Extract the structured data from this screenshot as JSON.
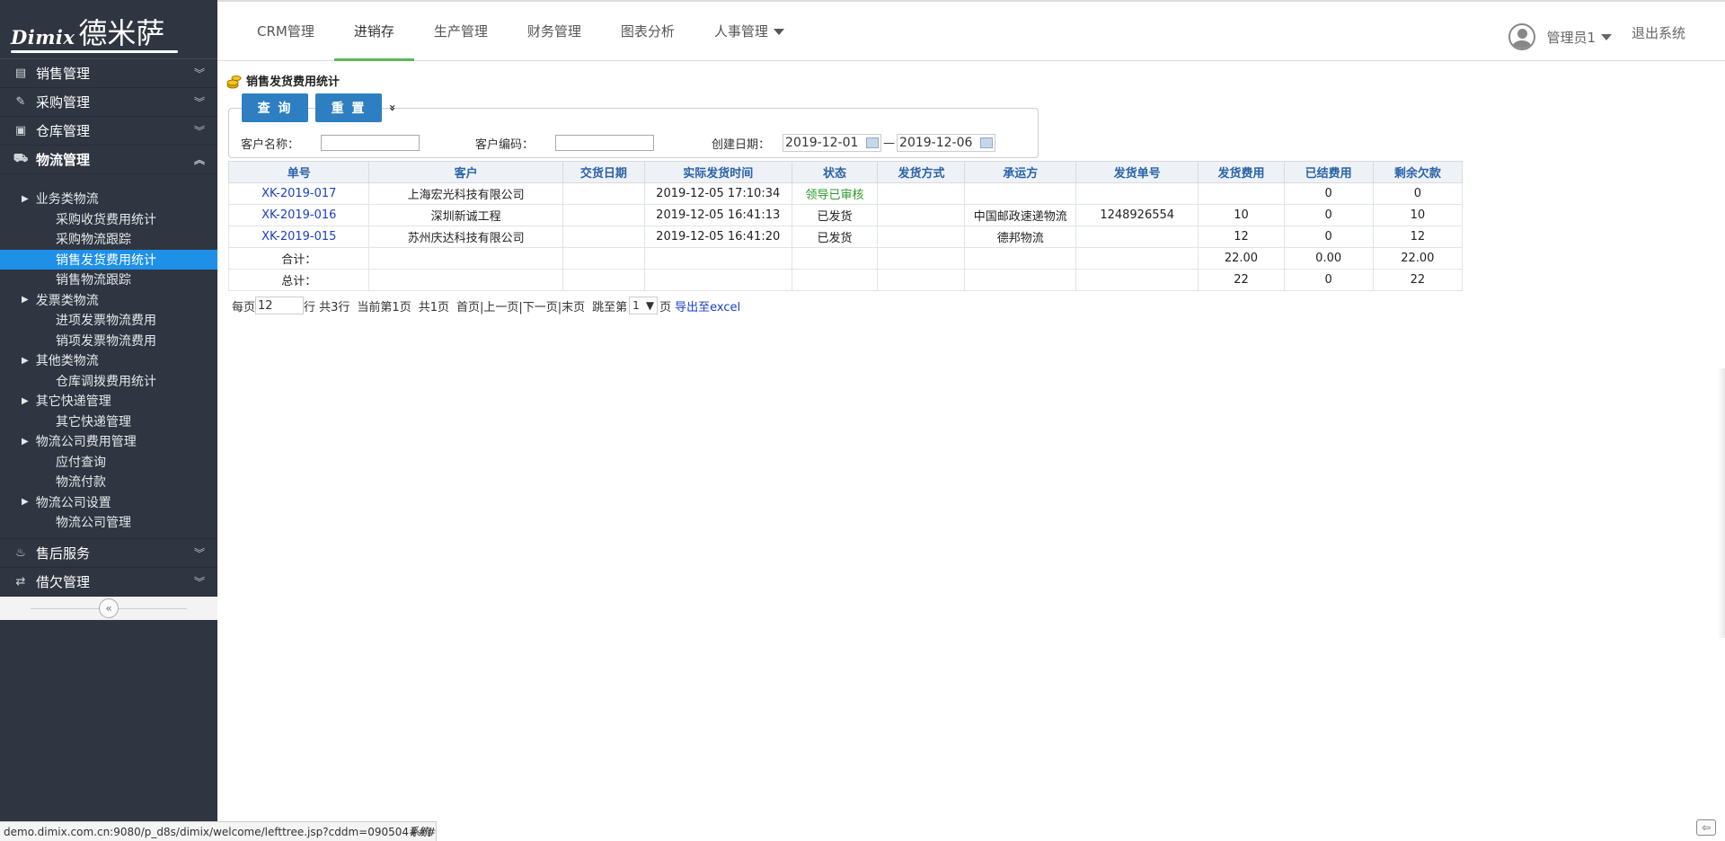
{
  "logo": {
    "en": "Dimix",
    "cn": "德米萨"
  },
  "sidebar": {
    "menus_top": [
      {
        "label": "销售管理",
        "icon": "table-icon",
        "glyph": "▤"
      },
      {
        "label": "采购管理",
        "icon": "edit-icon",
        "glyph": "✎"
      },
      {
        "label": "仓库管理",
        "icon": "warehouse-icon",
        "glyph": "▣"
      },
      {
        "label": "物流管理",
        "icon": "logistics-icon",
        "glyph": "⛟"
      }
    ],
    "tree": [
      {
        "type": "group",
        "label": "业务类物流"
      },
      {
        "type": "leaf",
        "label": "采购收货费用统计"
      },
      {
        "type": "leaf",
        "label": "采购物流跟踪"
      },
      {
        "type": "leaf",
        "label": "销售发货费用统计",
        "active": true
      },
      {
        "type": "leaf",
        "label": "销售物流跟踪"
      },
      {
        "type": "group",
        "label": "发票类物流"
      },
      {
        "type": "leaf",
        "label": "进项发票物流费用"
      },
      {
        "type": "leaf",
        "label": "销项发票物流费用"
      },
      {
        "type": "group",
        "label": "其他类物流"
      },
      {
        "type": "leaf",
        "label": "仓库调拨费用统计"
      },
      {
        "type": "group",
        "label": "其它快递管理"
      },
      {
        "type": "leaf",
        "label": "其它快递管理"
      },
      {
        "type": "group",
        "label": "物流公司费用管理"
      },
      {
        "type": "leaf",
        "label": "应付查询"
      },
      {
        "type": "leaf",
        "label": "物流付款"
      },
      {
        "type": "group",
        "label": "物流公司设置"
      },
      {
        "type": "leaf",
        "label": "物流公司管理"
      }
    ],
    "menus_bottom": [
      {
        "label": "售后服务",
        "icon": "fire-icon",
        "glyph": "♨"
      },
      {
        "label": "借欠管理",
        "icon": "retweet-icon",
        "glyph": "⇄"
      }
    ],
    "collapse_glyph": "«"
  },
  "topnav": {
    "tabs": [
      "CRM管理",
      "进销存",
      "生产管理",
      "财务管理",
      "图表分析",
      "人事管理"
    ],
    "active_index": 1,
    "user": "管理员1",
    "logout": "退出系统"
  },
  "page": {
    "title": "销售发货费用统计",
    "query_btn": "查 询",
    "reset_btn": "重 置",
    "toggle_glyph": "»",
    "customer_name_label": "客户名称：",
    "customer_code_label": "客户编码：",
    "created_date_label": "创建日期：",
    "date_from": "2019-12-01",
    "date_to": "2019-12-06",
    "date_sep": "—"
  },
  "table": {
    "headers": [
      "单号",
      "客户",
      "交货日期",
      "实际发货时间",
      "状态",
      "发货方式",
      "承运方",
      "发货单号",
      "发货费用",
      "已结费用",
      "剩余欠款"
    ],
    "rows": [
      [
        "XK-2019-017",
        "上海宏光科技有限公司",
        "",
        "2019-12-05 17:10:34",
        "领导已审核",
        "",
        "",
        "",
        "",
        "0",
        "0"
      ],
      [
        "XK-2019-016",
        "深圳新诚工程",
        "",
        "2019-12-05 16:41:13",
        "已发货",
        "",
        "中国邮政速递物流",
        "1248926554",
        "10",
        "0",
        "10"
      ],
      [
        "XK-2019-015",
        "苏州庆达科技有限公司",
        "",
        "2019-12-05 16:41:20",
        "已发货",
        "",
        "德邦物流",
        "",
        "12",
        "0",
        "12"
      ],
      [
        "合计：",
        "",
        "",
        "",
        "",
        "",
        "",
        "",
        "22.00",
        "0.00",
        "22.00"
      ],
      [
        "总计：",
        "",
        "",
        "",
        "",
        "",
        "",
        "",
        "22",
        "0",
        "22"
      ]
    ]
  },
  "pager": {
    "per_page_label": "每页",
    "per_page_value": "12",
    "rows_text": "行 共3行",
    "current_text": "当前第1页",
    "total_text": "共1页",
    "nav_text": "首页|上一页|下一页|末页",
    "jump_label": "跳至第",
    "jump_value": "1",
    "page_unit": "页",
    "export": "导出至excel"
  },
  "statusbar": {
    "url": "demo.dimix.com.cn:9080/p_d8s/dimix/welcome/lefttree.jsp?cddm=090504###",
    "footer_partial": "系统"
  }
}
